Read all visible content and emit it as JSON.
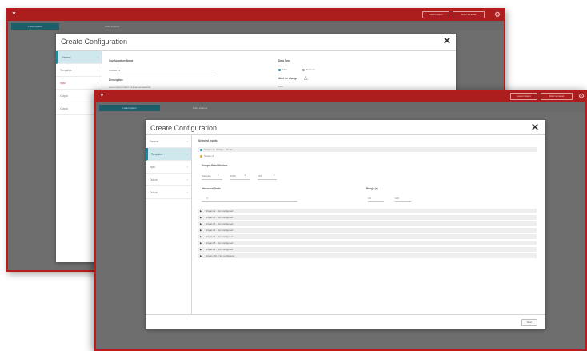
{
  "app": {
    "logo_icon": "app-logo-icon"
  },
  "colors": {
    "brand": "#ac1d1d",
    "accent": "#1c5e6a",
    "nav_active": "#cfe8ee"
  },
  "titlebar": {
    "button1": "Lorem ipsum",
    "button2": "Dolor sit amet",
    "gear_icon": "gear-icon"
  },
  "tabs": [
    {
      "label": "Lorem ipsum"
    },
    {
      "label": "Dolor sit amet"
    }
  ],
  "dialog": {
    "title": "Create Configuration",
    "close_icon": "close-icon",
    "footer_button": "Next"
  },
  "nav": [
    {
      "label": "General"
    },
    {
      "label": "Templates"
    },
    {
      "label": "Input"
    },
    {
      "label": "Output"
    },
    {
      "label": "Output"
    }
  ],
  "back_form": {
    "config_name_label": "Configuration Name",
    "config_name_value": "Untitled 01",
    "description_label": "Description",
    "description_value": "Lorem ipsum dolor sit amet consectetur",
    "col2_label": "Data Type",
    "radio1": "Files",
    "radio2": "Network",
    "col2_label2": "Alert on change",
    "col2_value2": "Low"
  },
  "front_form": {
    "section_label": "Selected Inputs",
    "selected_row1": "Stream 1 - Voltage - 10 Hz",
    "selected_row2": "Stream 2",
    "sample_label": "Sample Rate/Window",
    "sample_unit": "Samples",
    "sample_count": "1000",
    "sample_window": "100",
    "left_label": "Measured Units",
    "left_value": "V",
    "right_label": "Range (s)",
    "right_min": "0.0",
    "right_max": "100"
  },
  "list_rows": [
    "Stream 3 - Not configured",
    "Stream 4 - Not configured",
    "Stream 5 - Not configured",
    "Stream 6 - Not configured",
    "Stream 7 - Not configured",
    "Stream 8 - Not configured",
    "Stream 9 - Not configured",
    "Stream 10 - Not configured"
  ]
}
